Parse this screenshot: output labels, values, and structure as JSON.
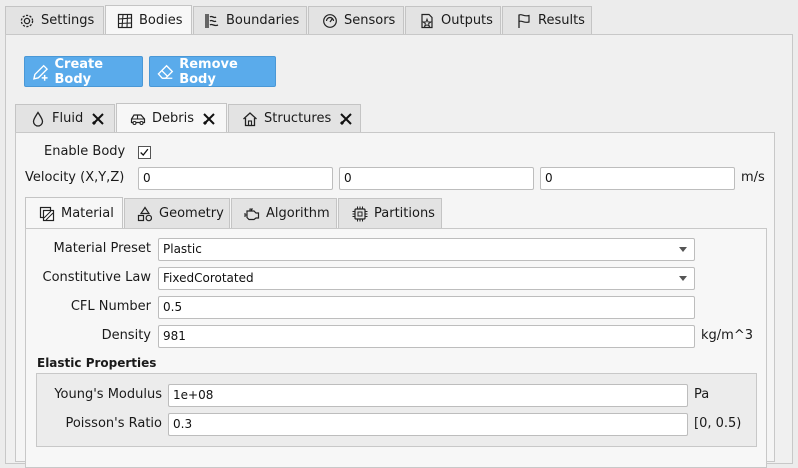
{
  "top_tabs": [
    {
      "label": "Settings",
      "icon": "gear-icon"
    },
    {
      "label": "Bodies",
      "icon": "grid-icon"
    },
    {
      "label": "Boundaries",
      "icon": "wave-wall-icon"
    },
    {
      "label": "Sensors",
      "icon": "sensor-icon"
    },
    {
      "label": "Outputs",
      "icon": "file-icon"
    },
    {
      "label": "Results",
      "icon": "flag-icon"
    }
  ],
  "toolbar": {
    "create_label": "Create Body",
    "remove_label": "Remove Body"
  },
  "body_tabs": [
    {
      "label": "Fluid",
      "icon": "droplet-icon"
    },
    {
      "label": "Debris",
      "icon": "car-icon"
    },
    {
      "label": "Structures",
      "icon": "house-icon"
    }
  ],
  "body": {
    "enable_label": "Enable Body",
    "enable_checked": true,
    "velocity_label": "Velocity (X,Y,Z)",
    "velocity": [
      "0",
      "0",
      "0"
    ],
    "velocity_unit": "m/s"
  },
  "sub_tabs": [
    {
      "label": "Material",
      "icon": "material-icon"
    },
    {
      "label": "Geometry",
      "icon": "shapes-icon"
    },
    {
      "label": "Algorithm",
      "icon": "engine-icon"
    },
    {
      "label": "Partitions",
      "icon": "chip-icon"
    }
  ],
  "material": {
    "preset_label": "Material Preset",
    "preset_value": "Plastic",
    "law_label": "Constitutive Law",
    "law_value": "FixedCorotated",
    "cfl_label": "CFL Number",
    "cfl_value": "0.5",
    "density_label": "Density",
    "density_value": "981",
    "density_unit": "kg/m^3"
  },
  "elastic": {
    "title": "Elastic Properties",
    "youngs_label": "Young's Modulus",
    "youngs_value": "1e+08",
    "youngs_unit": "Pa",
    "poisson_label": "Poisson's Ratio",
    "poisson_value": "0.3",
    "poisson_unit": "[0, 0.5)"
  }
}
